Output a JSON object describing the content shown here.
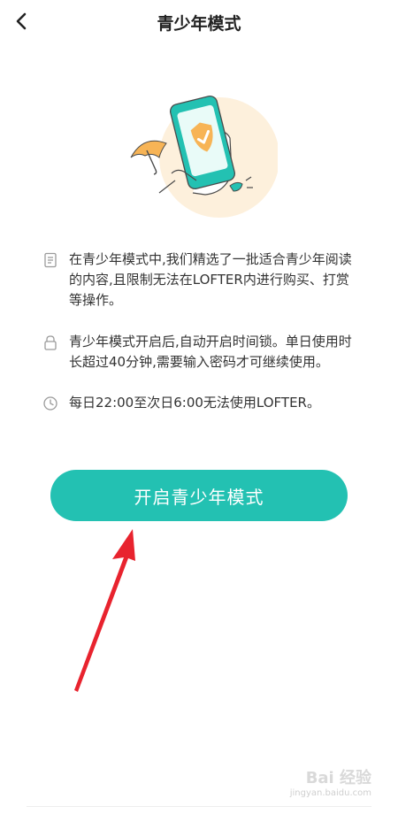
{
  "header": {
    "title": "青少年模式",
    "back_icon": "chevron-left-icon"
  },
  "hero": {
    "icon": "phone-shield-check-illustration",
    "colors": {
      "circle": "#fdf0dc",
      "phone": "#23c1b2",
      "shield": "#f7b456",
      "umbrella": "#f7b456"
    }
  },
  "info": {
    "items": [
      {
        "icon": "document-icon",
        "text": "在青少年模式中,我们精选了一批适合青少年阅读的内容,且限制无法在LOFTER内进行购买、打赏等操作。"
      },
      {
        "icon": "lock-icon",
        "text": "青少年模式开启后,自动开启时间锁。单日使用时长超过40分钟,需要输入密码才可继续使用。"
      },
      {
        "icon": "clock-icon",
        "text": "每日22:00至次日6:00无法使用LOFTER。"
      }
    ]
  },
  "action": {
    "label": "开启青少年模式",
    "color": "#23c1b2"
  },
  "annotation": {
    "icon": "red-arrow-pointer",
    "color": "#e8232e"
  },
  "watermark": {
    "brand": "Bai 经验",
    "url": "jingyan.baidu.com"
  }
}
